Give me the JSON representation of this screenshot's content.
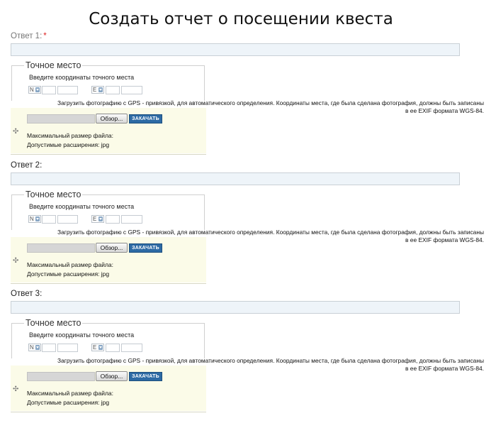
{
  "page": {
    "title": "Создать отчет о посещении квеста"
  },
  "answers": [
    {
      "label": "Ответ 1:",
      "required_mark": "*",
      "input_value": "",
      "location": {
        "legend": "Точное место",
        "coords_label": "Введите координаты точного места",
        "lat_dir": "N",
        "lon_dir": "E"
      },
      "upload": {
        "description_line1": "Загрузить фотографию с GPS - привязкой, для автоматического определения. Координаты места, где была сделана фотография, должны быть записаны",
        "description_line2": "в ее EXIF формата WGS-84.",
        "browse_label": "Обзор...",
        "upload_label": "ЗАКАЧАТЬ",
        "max_size_label": "Максимальный размер файла:",
        "extensions_label": "Допустимые расширения: jpg"
      }
    },
    {
      "label": "Ответ 2:",
      "input_value": "",
      "location": {
        "legend": "Точное место",
        "coords_label": "Введите координаты точного места",
        "lat_dir": "N",
        "lon_dir": "E"
      },
      "upload": {
        "description_line1": "Загрузить фотографию с GPS - привязкой, для автоматического определения. Координаты места, где была сделана фотография, должны быть записаны",
        "description_line2": "в ее EXIF формата WGS-84.",
        "browse_label": "Обзор...",
        "upload_label": "ЗАКАЧАТЬ",
        "max_size_label": "Максимальный размер файла:",
        "extensions_label": "Допустимые расширения: jpg"
      }
    },
    {
      "label": "Ответ 3:",
      "input_value": "",
      "location": {
        "legend": "Точное место",
        "coords_label": "Введите координаты точного места",
        "lat_dir": "N",
        "lon_dir": "E"
      },
      "upload": {
        "description_line1": "Загрузить фотографию с GPS - привязкой, для автоматического определения. Координаты места, где была сделана фотография, должны быть записаны",
        "description_line2": "в ее EXIF формата WGS-84.",
        "browse_label": "Обзор...",
        "upload_label": "ЗАКАЧАТЬ",
        "max_size_label": "Максимальный размер файла:",
        "extensions_label": "Допустимые расширения: jpg"
      }
    }
  ],
  "icons": {
    "drag_handle": "move-icon"
  },
  "colors": {
    "upload_button": "#2d6aa4",
    "upload_area": "#fbfbe8",
    "input_bg": "#eef4f9",
    "required": "#dd2222"
  }
}
